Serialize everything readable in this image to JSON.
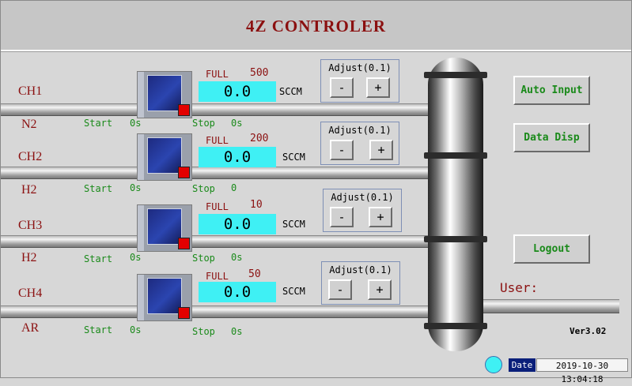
{
  "title": "4Z  CONTROLER",
  "channels": [
    {
      "name": "CH1",
      "gas": "N2",
      "full_label": "FULL",
      "full": "500",
      "value": "0.0",
      "unit": "SCCM",
      "adjust_label": "Adjust(0.1)",
      "minus": "-",
      "plus": "+",
      "start_label": "Start",
      "start": "0s",
      "stop_label": "Stop",
      "stop": "0s"
    },
    {
      "name": "CH2",
      "gas": "H2",
      "full_label": "FULL",
      "full": "200",
      "value": "0.0",
      "unit": "SCCM",
      "adjust_label": "Adjust(0.1)",
      "minus": "-",
      "plus": "+",
      "start_label": "Start",
      "start": "0s",
      "stop_label": "Stop",
      "stop": "0"
    },
    {
      "name": "CH3",
      "gas": "H2",
      "full_label": "FULL",
      "full": "10",
      "value": "0.0",
      "unit": "SCCM",
      "adjust_label": "Adjust(0.1)",
      "minus": "-",
      "plus": "+",
      "start_label": "Start",
      "start": "0s",
      "stop_label": "Stop",
      "stop": "0s"
    },
    {
      "name": "CH4",
      "gas": "AR",
      "full_label": "FULL",
      "full": "50",
      "value": "0.0",
      "unit": "SCCM",
      "adjust_label": "Adjust(0.1)",
      "minus": "-",
      "plus": "+",
      "start_label": "Start",
      "start": "0s",
      "stop_label": "Stop",
      "stop": "0s"
    }
  ],
  "buttons": {
    "auto_input": "Auto Input",
    "data_disp": "Data Disp",
    "logout": "Logout"
  },
  "user_label": "User:",
  "version": "Ver3.02",
  "date_label": "Date",
  "datetime": "2019-10-30 13:04:18",
  "colors": {
    "readout": "#3ff0f4",
    "label_red": "#8b1010",
    "green_text": "#1a8a1a",
    "status_red": "#e30000"
  },
  "icons": [
    "mass-flow-controller-icon",
    "status-indicator-icon",
    "reactor-column-icon",
    "status-dot-icon"
  ]
}
